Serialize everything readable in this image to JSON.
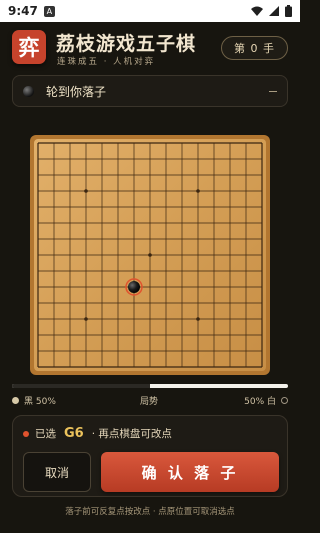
{
  "status_bar": {
    "time": "9:47",
    "notification_glyph": "A",
    "icons": [
      "wifi-icon",
      "signal-icon",
      "battery-icon"
    ]
  },
  "header": {
    "logo_glyph": "弈",
    "title": "荔枝游戏五子棋",
    "subtitle": "连珠成五 · 人机对弈",
    "move_counter": "第 0 手"
  },
  "turn_panel": {
    "text": "轮到你落子",
    "stone_color": "black"
  },
  "board": {
    "size": 15,
    "star_points": [
      [
        "D",
        4
      ],
      [
        "L",
        4
      ],
      [
        "H",
        8
      ],
      [
        "D",
        12
      ],
      [
        "L",
        12
      ]
    ],
    "stones": [],
    "selected": {
      "coord": "G6",
      "color": "black"
    },
    "colors": {
      "wood": "#d9a55c",
      "grid": "#3b2611",
      "frame": "#b27630",
      "highlight": "#e0532e"
    }
  },
  "momentum": {
    "black_label": "黑 50%",
    "center_label": "局势",
    "white_label": "50% 白",
    "black_share": 0.5
  },
  "selection": {
    "prefix": "已选",
    "coord": "G6",
    "hint": "· 再点棋盘可改点"
  },
  "buttons": {
    "cancel": "取消",
    "confirm": "确 认 落 子"
  },
  "footer_hint": "落子前可反复点按改点 · 点原位置可取消选点",
  "colors": {
    "background": "#17150f",
    "accent_red": "#d9583c",
    "accent_gold": "#ecc35c"
  }
}
